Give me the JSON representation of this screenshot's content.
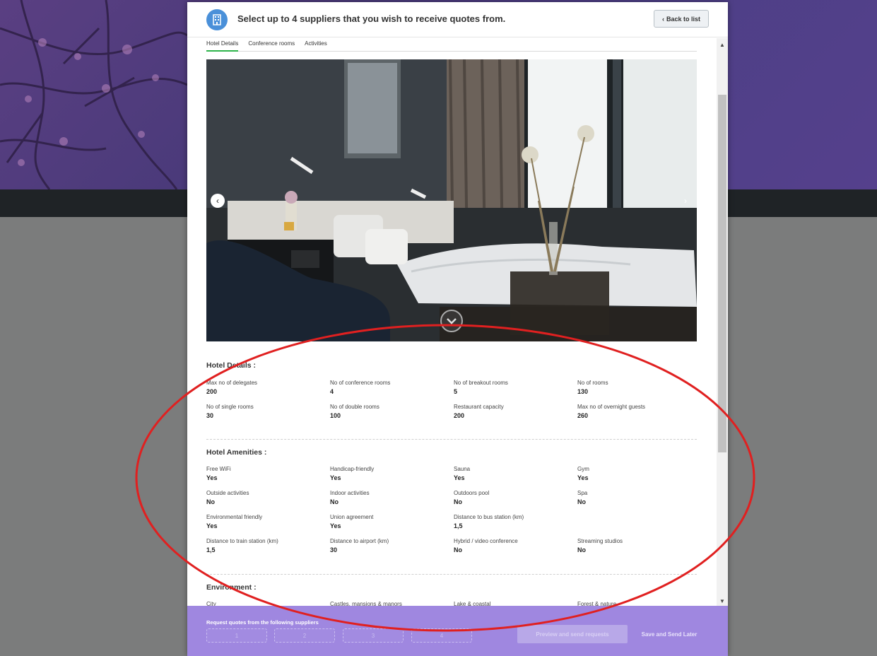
{
  "header": {
    "title": "Select up to 4 suppliers that you wish to receive quotes from.",
    "back_label": "Back to list",
    "icon": "building-icon"
  },
  "tabs": [
    {
      "label": "Hotel Details",
      "active": true
    },
    {
      "label": "Conference rooms",
      "active": false
    },
    {
      "label": "Activities",
      "active": false
    }
  ],
  "carousel": {
    "prev_icon": "chevron-left-icon",
    "next_icon": "chevron-right-icon",
    "toggle_icon": "chevron-down-icon",
    "prev_glyph": "‹",
    "next_glyph": "›"
  },
  "hotel_details": {
    "title": "Hotel Details :",
    "items": [
      {
        "label": "Max no of delegates",
        "value": "200"
      },
      {
        "label": "No of conference rooms",
        "value": "4"
      },
      {
        "label": "No of breakout rooms",
        "value": "5"
      },
      {
        "label": "No of rooms",
        "value": "130"
      },
      {
        "label": "No of single rooms",
        "value": "30"
      },
      {
        "label": "No of double rooms",
        "value": "100"
      },
      {
        "label": "Restaurant capacity",
        "value": "200"
      },
      {
        "label": "Max no of overnight guests",
        "value": "260"
      }
    ]
  },
  "hotel_amenities": {
    "title": "Hotel Amenities :",
    "items": [
      {
        "label": "Free WiFi",
        "value": "Yes"
      },
      {
        "label": "Handicap-friendly",
        "value": "Yes"
      },
      {
        "label": "Sauna",
        "value": "Yes"
      },
      {
        "label": "Gym",
        "value": "Yes"
      },
      {
        "label": "Outside activities",
        "value": "No"
      },
      {
        "label": "Indoor activities",
        "value": "No"
      },
      {
        "label": "Outdoors pool",
        "value": "No"
      },
      {
        "label": "Spa",
        "value": "No"
      },
      {
        "label": "Environmental friendly",
        "value": "Yes"
      },
      {
        "label": "Union agreement",
        "value": "Yes"
      },
      {
        "label": "Distance to bus station (km)",
        "value": "1,5"
      },
      {
        "label": "",
        "value": ""
      },
      {
        "label": "Distance to train station (km)",
        "value": "1,5"
      },
      {
        "label": "Distance to airport (km)",
        "value": "30"
      },
      {
        "label": "Hybrid / video conference",
        "value": "No"
      },
      {
        "label": "Streaming studios",
        "value": "No"
      }
    ]
  },
  "environment": {
    "title": "Environment :",
    "items": [
      {
        "label": "City"
      },
      {
        "label": "Castles, mansions & manors"
      },
      {
        "label": "Lake & coastal"
      },
      {
        "label": "Forest & nature"
      }
    ]
  },
  "footer": {
    "label": "Request quotes from the following suppliers",
    "slots": [
      "1",
      "2",
      "3",
      "4"
    ],
    "preview_label": "Preview and send requests",
    "save_later_label": "Save and Send Later"
  },
  "colors": {
    "accent_tab": "#2db34a",
    "footer_bg": "#9f87e0",
    "annotation": "#e02020",
    "header_icon_bg": "#4a90d9"
  }
}
